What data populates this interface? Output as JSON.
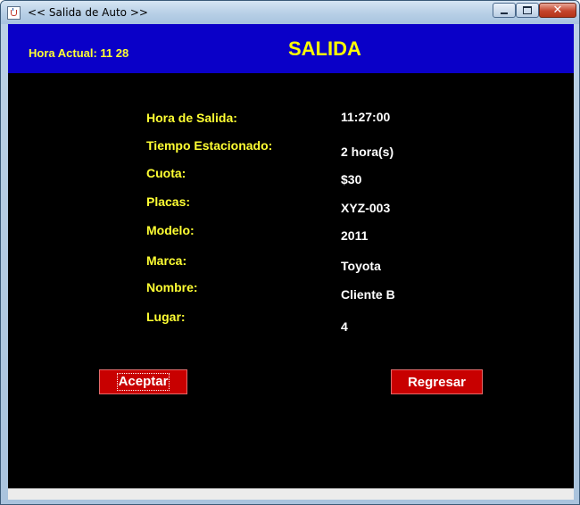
{
  "window": {
    "title": "<< Salida de Auto >>",
    "icons": {
      "app": "java-cup-icon",
      "minimize": "minimize-icon",
      "maximize": "maximize-icon",
      "close": "close-icon"
    }
  },
  "header": {
    "current_time_label": "Hora Actual:  11 28",
    "title": "SALIDA"
  },
  "details": [
    {
      "label": "Hora de Salida:",
      "value": "11:27:00"
    },
    {
      "label": "Tiempo Estacionado:",
      "value": "2 hora(s)"
    },
    {
      "label": "Cuota:",
      "value": "$30"
    },
    {
      "label": "Placas:",
      "value": "XYZ-003"
    },
    {
      "label": "Modelo:",
      "value": "2011"
    },
    {
      "label": "Marca:",
      "value": "Toyota"
    },
    {
      "label": "Nombre:",
      "value": "Cliente B"
    },
    {
      "label": "Lugar:",
      "value": "4"
    }
  ],
  "buttons": {
    "accept": "Aceptar",
    "back": "Regresar"
  },
  "colors": {
    "header_bg": "#0a00c8",
    "label_text": "#ffff33",
    "value_text": "#ffffff",
    "content_bg": "#000000",
    "button_bg": "#c80000"
  }
}
